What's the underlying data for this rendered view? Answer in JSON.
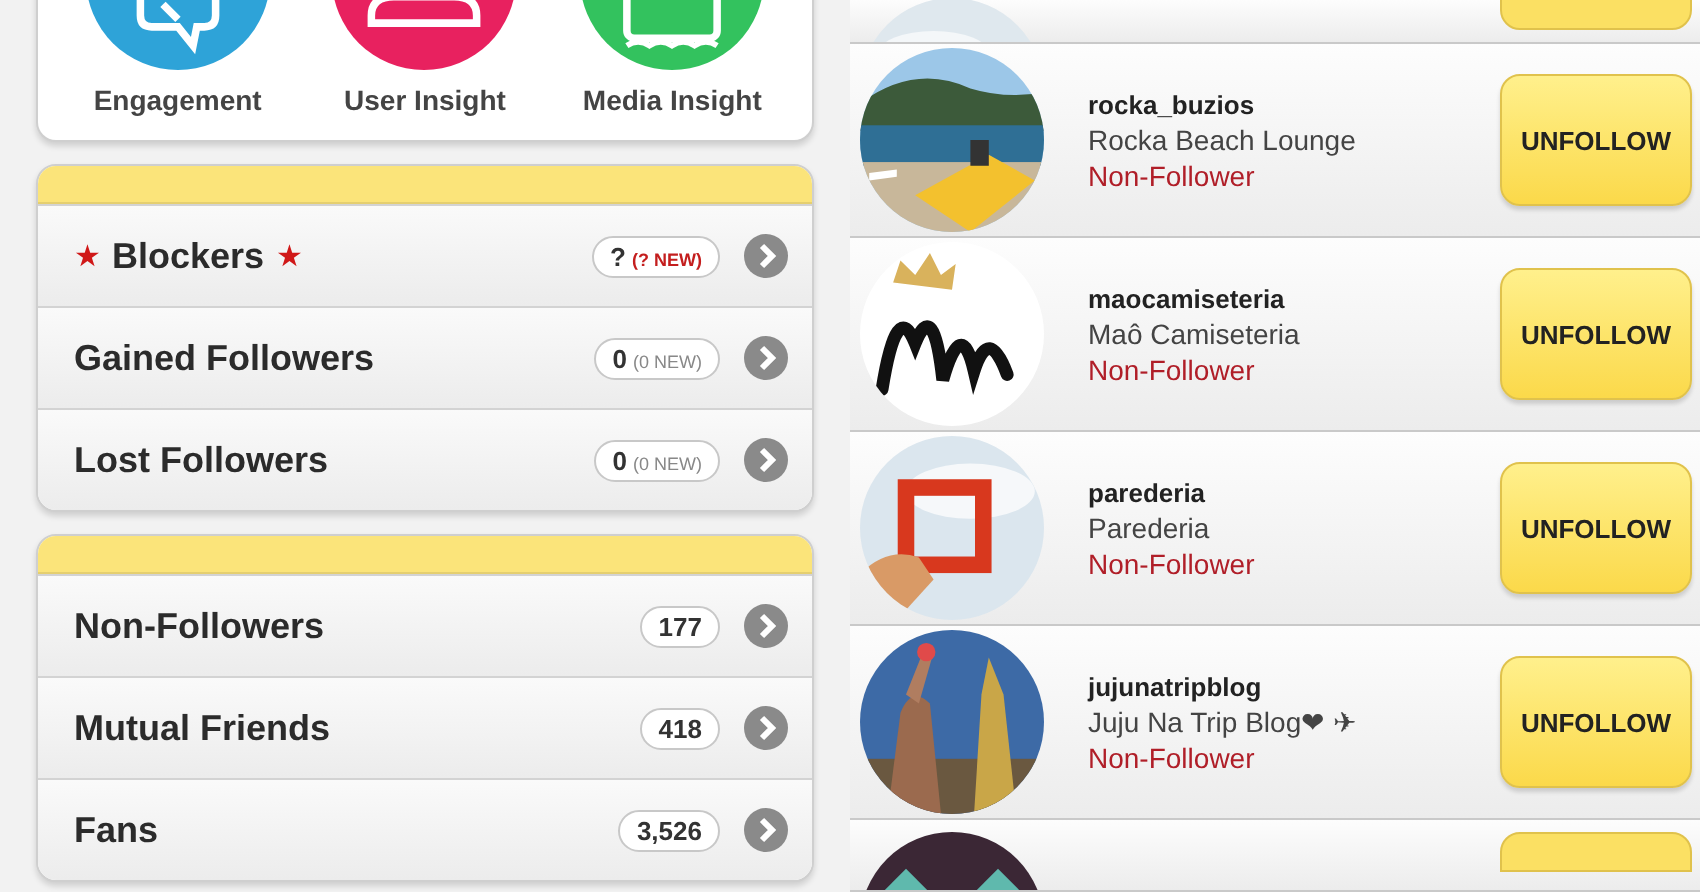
{
  "tiles": [
    {
      "kind": "engagement",
      "label": "Engagement"
    },
    {
      "kind": "user",
      "label": "User Insight"
    },
    {
      "kind": "media",
      "label": "Media Insight"
    }
  ],
  "cards": [
    {
      "rows": [
        {
          "label": "Blockers",
          "star_before": "★",
          "star_after": "★",
          "count": "?",
          "new": "(? NEW)",
          "new_highlight": true
        },
        {
          "label": "Gained Followers",
          "count": "0",
          "new": "(0 NEW)",
          "new_highlight": false
        },
        {
          "label": "Lost Followers",
          "count": "0",
          "new": "(0 NEW)",
          "new_highlight": false
        }
      ]
    },
    {
      "rows": [
        {
          "label": "Non-Followers",
          "count": "177"
        },
        {
          "label": "Mutual Friends",
          "count": "418"
        },
        {
          "label": "Fans",
          "count": "3,526"
        }
      ]
    }
  ],
  "users": [
    {
      "kind": "partial_top"
    },
    {
      "kind": "full",
      "username": "rocka_buzios",
      "full_name": "Rocka Beach Lounge",
      "status": "Non-Follower",
      "button": "UNFOLLOW"
    },
    {
      "kind": "full",
      "username": "maocamiseteria",
      "full_name": "Maô Camiseteria",
      "status": "Non-Follower",
      "button": "UNFOLLOW"
    },
    {
      "kind": "full",
      "username": "parederia",
      "full_name": "Parederia",
      "status": "Non-Follower",
      "button": "UNFOLLOW"
    },
    {
      "kind": "full",
      "username": "jujunatripblog",
      "full_name": "Juju Na Trip Blog❤ ✈",
      "status": "Non-Follower",
      "button": "UNFOLLOW"
    },
    {
      "kind": "partial_bottom"
    }
  ]
}
